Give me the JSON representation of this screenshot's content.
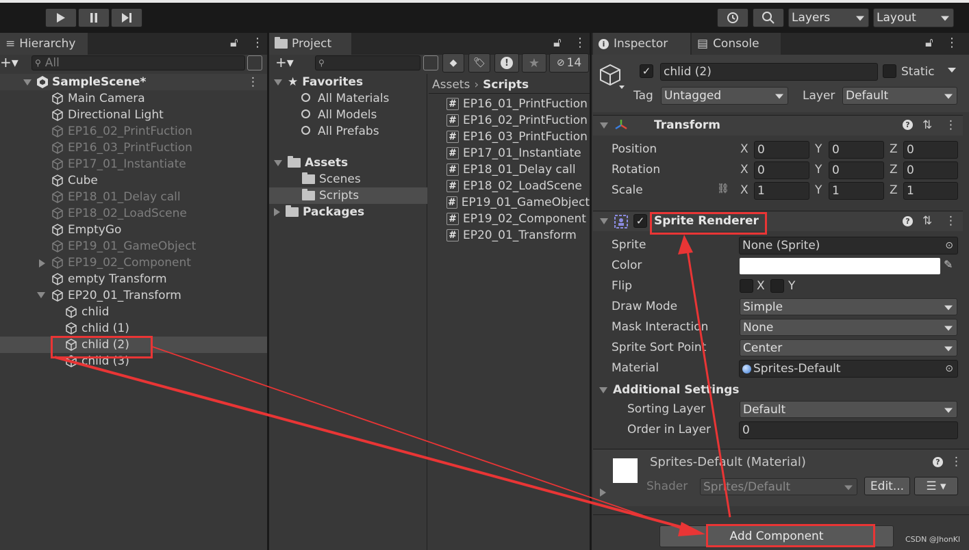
{
  "toolbar": {
    "layers_label": "Layers",
    "layout_label": "Layout"
  },
  "hierarchy": {
    "tab": "Hierarchy",
    "search_placeholder": "All",
    "scene": "SampleScene*",
    "items": [
      {
        "label": "Main Camera",
        "dim": false
      },
      {
        "label": "Directional Light",
        "dim": false
      },
      {
        "label": "EP16_02_PrintFuction",
        "dim": true
      },
      {
        "label": "EP16_03_PrintFuction",
        "dim": true
      },
      {
        "label": "EP17_01_Instantiate",
        "dim": true
      },
      {
        "label": "Cube",
        "dim": false
      },
      {
        "label": "EP18_01_Delay call",
        "dim": true
      },
      {
        "label": "EP18_02_LoadScene",
        "dim": true
      },
      {
        "label": "EmptyGo",
        "dim": false
      },
      {
        "label": "EP19_01_GameObject",
        "dim": true
      },
      {
        "label": "EP19_02_Component",
        "dim": true
      },
      {
        "label": "empty Transform",
        "dim": false
      },
      {
        "label": "EP20_01_Transform",
        "dim": false
      }
    ],
    "children": [
      "chlid",
      "chlid (1)",
      "chlid (2)",
      "chlid (3)"
    ]
  },
  "project": {
    "tab": "Project",
    "hidden_count": "14",
    "favorites": "Favorites",
    "favorite_items": [
      "All Materials",
      "All Models",
      "All Prefabs"
    ],
    "assets": "Assets",
    "asset_items": [
      "Scenes",
      "Scripts"
    ],
    "packages": "Packages",
    "breadcrumb_root": "Assets",
    "breadcrumb_current": "Scripts",
    "files": [
      "EP16_01_PrintFuction",
      "EP16_02_PrintFuction",
      "EP16_03_PrintFuction",
      "EP17_01_Instantiate",
      "EP18_01_Delay call",
      "EP18_02_LoadScene",
      "EP19_01_GameObject",
      "EP19_02_Component",
      "EP20_01_Transform"
    ]
  },
  "inspector": {
    "tab": "Inspector",
    "console_tab": "Console",
    "object_name": "chlid (2)",
    "static_label": "Static",
    "tag_label": "Tag",
    "tag_value": "Untagged",
    "layer_label": "Layer",
    "layer_value": "Default",
    "transform": {
      "title": "Transform",
      "position_label": "Position",
      "rotation_label": "Rotation",
      "scale_label": "Scale",
      "position": [
        "0",
        "0",
        "0"
      ],
      "rotation": [
        "0",
        "0",
        "0"
      ],
      "scale": [
        "1",
        "1",
        "1"
      ],
      "x": "X",
      "y": "Y",
      "z": "Z"
    },
    "sprite_renderer": {
      "title": "Sprite Renderer",
      "sprite_label": "Sprite",
      "sprite_value": "None (Sprite)",
      "color_label": "Color",
      "color_value": "#ffffff",
      "flip_label": "Flip",
      "flip_x": "X",
      "flip_y": "Y",
      "draw_mode_label": "Draw Mode",
      "draw_mode_value": "Simple",
      "mask_label": "Mask Interaction",
      "mask_value": "None",
      "sort_point_label": "Sprite Sort Point",
      "sort_point_value": "Center",
      "material_label": "Material",
      "material_value": "Sprites-Default",
      "additional_label": "Additional Settings",
      "sorting_layer_label": "Sorting Layer",
      "sorting_layer_value": "Default",
      "order_label": "Order in Layer",
      "order_value": "0"
    },
    "material": {
      "title": "Sprites-Default (Material)",
      "shader_label": "Shader",
      "shader_value": "Sprites/Default",
      "edit_label": "Edit..."
    },
    "add_component": "Add Component"
  },
  "watermark": "CSDN @JhonKl",
  "colors": {
    "highlight_red": "#e93535",
    "panel_bg": "#383838",
    "selection": "#4d4d4d"
  }
}
